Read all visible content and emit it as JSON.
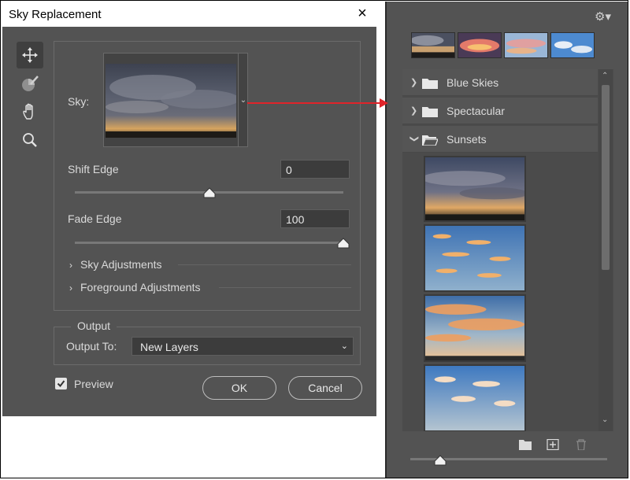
{
  "dialog": {
    "title": "Sky Replacement",
    "close_glyph": "×",
    "tools": [
      "move-icon",
      "sky-brush-icon",
      "hand-icon",
      "zoom-icon"
    ],
    "sky_label": "Sky:",
    "shift_edge": {
      "label": "Shift Edge",
      "value": "0",
      "slider_fraction": 0.5
    },
    "fade_edge": {
      "label": "Fade Edge",
      "value": "100",
      "slider_fraction": 1.0
    },
    "expanders": [
      {
        "label": "Sky Adjustments"
      },
      {
        "label": "Foreground Adjustments"
      }
    ],
    "output": {
      "legend": "Output",
      "output_to_label": "Output To:",
      "output_to_value": "New Layers"
    },
    "preview": {
      "label": "Preview",
      "checked": true
    },
    "ok_label": "OK",
    "cancel_label": "Cancel"
  },
  "library": {
    "folders": [
      {
        "name": "Blue Skies",
        "expanded": false
      },
      {
        "name": "Spectacular",
        "expanded": false
      },
      {
        "name": "Sunsets",
        "expanded": true
      }
    ]
  },
  "colors": {
    "dialog_bg": "#535353",
    "arrow": "#e0242a"
  }
}
